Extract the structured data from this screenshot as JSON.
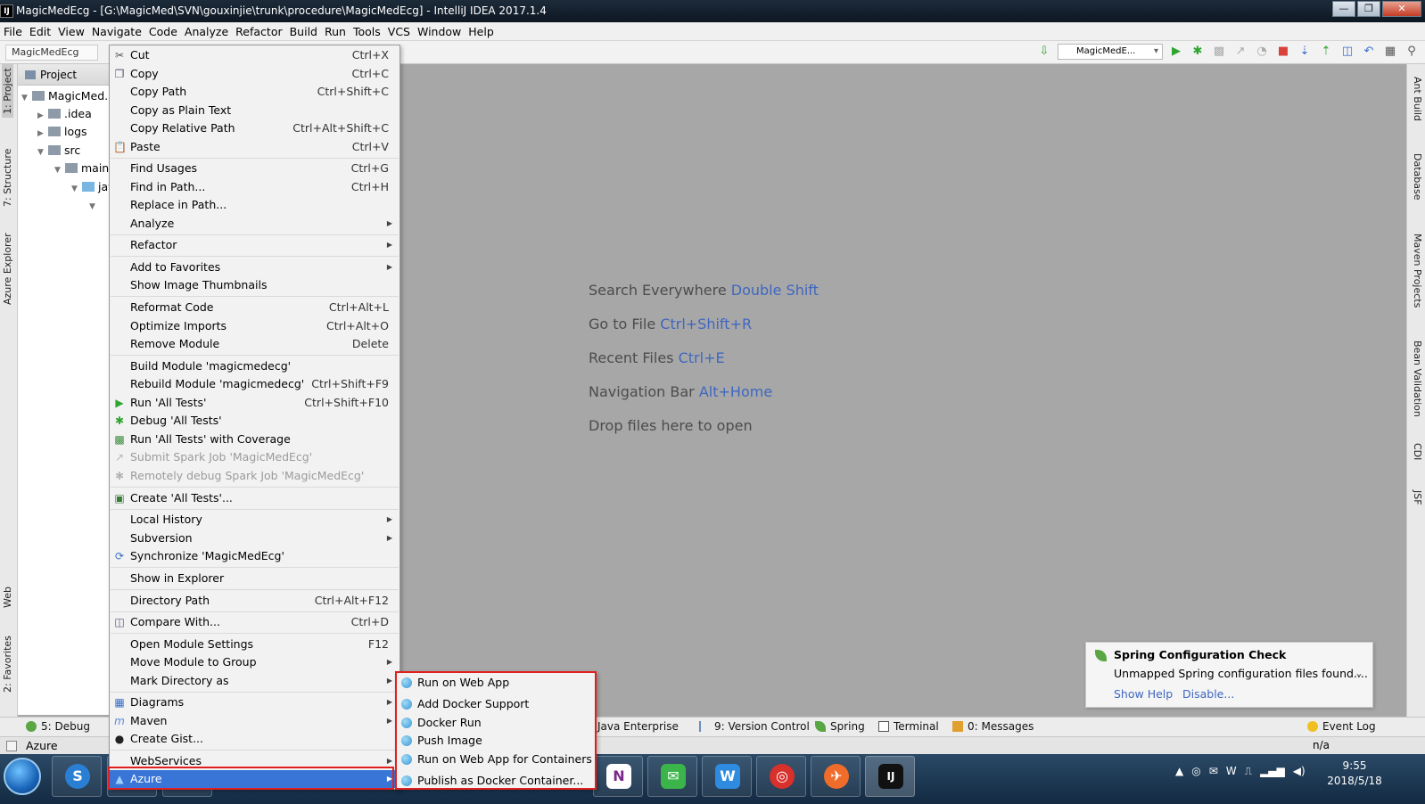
{
  "window": {
    "app_icon": "IJ",
    "title": "MagicMedEcg - [G:\\MagicMed\\SVN\\gouxinjie\\trunk\\procedure\\MagicMedEcg] - IntelliJ IDEA 2017.1.4",
    "btn_min": "—",
    "btn_max": "❐",
    "btn_close": "✕"
  },
  "menubar": [
    "File",
    "Edit",
    "View",
    "Navigate",
    "Code",
    "Analyze",
    "Refactor",
    "Build",
    "Run",
    "Tools",
    "VCS",
    "Window",
    "Help"
  ],
  "toolbar": {
    "breadcrumb": "MagicMedEcg",
    "run_config": "MagicMedE..."
  },
  "left_tabs": [
    "1: Project",
    "7: Structure",
    "Azure Explorer",
    "Web",
    "2: Favorites"
  ],
  "project": {
    "header": "Project",
    "tree": [
      {
        "label": "MagicMed...",
        "twisty": "▼"
      },
      {
        "label": ".idea",
        "twisty": "▶"
      },
      {
        "label": "logs",
        "twisty": "▶"
      },
      {
        "label": "src",
        "twisty": "▼"
      },
      {
        "label": "main",
        "twisty": "▼"
      },
      {
        "label": "java",
        "twisty": "▼"
      },
      {
        "label": "",
        "twisty": "▼"
      }
    ]
  },
  "context_menu": [
    {
      "label": "Cut",
      "key": "Ctrl+X",
      "icon": "scissors-icon"
    },
    {
      "label": "Copy",
      "key": "Ctrl+C",
      "icon": "copy-icon"
    },
    {
      "label": "Copy Path",
      "key": "Ctrl+Shift+C"
    },
    {
      "label": "Copy as Plain Text",
      "key": ""
    },
    {
      "label": "Copy Relative Path",
      "key": "Ctrl+Alt+Shift+C"
    },
    {
      "label": "Paste",
      "key": "Ctrl+V",
      "icon": "paste-icon"
    },
    {
      "label": "Find Usages",
      "key": "Ctrl+G"
    },
    {
      "label": "Find in Path...",
      "key": "Ctrl+H"
    },
    {
      "label": "Replace in Path...",
      "key": ""
    },
    {
      "label": "Analyze",
      "submenu": true
    },
    {
      "label": "Refactor",
      "submenu": true
    },
    {
      "label": "Add to Favorites",
      "submenu": true
    },
    {
      "label": "Show Image Thumbnails",
      "key": ""
    },
    {
      "label": "Reformat Code",
      "key": "Ctrl+Alt+L"
    },
    {
      "label": "Optimize Imports",
      "key": "Ctrl+Alt+O"
    },
    {
      "label": "Remove Module",
      "key": "Delete"
    },
    {
      "label": "Build Module 'magicmedecg'",
      "key": ""
    },
    {
      "label": "Rebuild Module 'magicmedecg'",
      "key": "Ctrl+Shift+F9"
    },
    {
      "label": "Run 'All Tests'",
      "key": "Ctrl+Shift+F10",
      "icon": "run-icon"
    },
    {
      "label": "Debug 'All Tests'",
      "key": "",
      "icon": "debug-icon"
    },
    {
      "label": "Run 'All Tests' with Coverage",
      "key": "",
      "icon": "coverage-icon"
    },
    {
      "label": "Submit Spark Job 'MagicMedEcg'",
      "key": "",
      "icon": "spark-icon",
      "disabled": true
    },
    {
      "label": "Remotely debug Spark Job 'MagicMedEcg'",
      "key": "",
      "icon": "remote-debug-icon",
      "disabled": true
    },
    {
      "label": "Create 'All Tests'...",
      "key": "",
      "icon": "create-test-icon"
    },
    {
      "label": "Local History",
      "submenu": true
    },
    {
      "label": "Subversion",
      "submenu": true
    },
    {
      "label": "Synchronize 'MagicMedEcg'",
      "key": "",
      "icon": "sync-icon"
    },
    {
      "label": "Show in Explorer",
      "key": ""
    },
    {
      "label": "Directory Path",
      "key": "Ctrl+Alt+F12"
    },
    {
      "label": "Compare With...",
      "key": "Ctrl+D",
      "icon": "compare-icon"
    },
    {
      "label": "Open Module Settings",
      "key": "F12"
    },
    {
      "label": "Move Module to Group",
      "submenu": true
    },
    {
      "label": "Mark Directory as",
      "submenu": true
    },
    {
      "label": "Diagrams",
      "submenu": true,
      "icon": "diagram-icon"
    },
    {
      "label": "Maven",
      "submenu": true,
      "icon": "maven-icon"
    },
    {
      "label": "Create Gist...",
      "key": "",
      "icon": "github-icon"
    },
    {
      "label": "WebServices",
      "submenu": true
    },
    {
      "label": "Azure",
      "submenu": true,
      "icon": "azure-icon",
      "selected": true
    }
  ],
  "azure_submenu": [
    "Run on Web App",
    "Add Docker Support",
    "Docker Run",
    "Push Image",
    "Run on Web App for Containers",
    "Publish as Docker Container..."
  ],
  "editor_hints": [
    {
      "text": "Search Everywhere",
      "shortcut": "Double Shift"
    },
    {
      "text": "Go to File",
      "shortcut": "Ctrl+Shift+R"
    },
    {
      "text": "Recent Files",
      "shortcut": "Ctrl+E"
    },
    {
      "text": "Navigation Bar",
      "shortcut": "Alt+Home"
    },
    {
      "text": "Drop files here to open",
      "shortcut": ""
    }
  ],
  "right_tabs": [
    "Ant Build",
    "Database",
    "Maven Projects",
    "Bean Validation",
    "CDI",
    "JSF"
  ],
  "bottom_tabs": [
    "5: Debug",
    "Java Enterprise",
    "9: Version Control",
    "Spring",
    "Terminal",
    "0: Messages",
    "Event Log"
  ],
  "status": {
    "text": "Azure",
    "right": "n/a"
  },
  "notification": {
    "title": "Spring Configuration Check",
    "body": "Unmapped Spring configuration files found....",
    "link1": "Show Help",
    "link2": "Disable..."
  },
  "taskbar": {
    "time": "9:55",
    "date": "2018/5/18",
    "apps": [
      "sogou-icon",
      "folder-icon",
      "chrome-icon",
      "onenote-icon",
      "wechat-icon",
      "wps-icon",
      "netease-music-icon",
      "postman-icon",
      "intellij-icon"
    ],
    "app_glyphs": [
      "S",
      "▦",
      "◉",
      "N",
      "✉",
      "W",
      "◎",
      "✈",
      "IJ"
    ]
  },
  "colors": {
    "accent": "#3875d7",
    "highlight": "#e02020",
    "shortcut": "#3f67c0"
  }
}
